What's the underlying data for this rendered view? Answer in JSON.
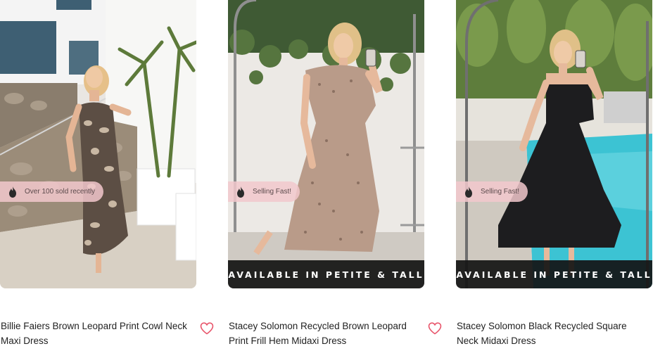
{
  "products": [
    {
      "title": "Billie Faiers Brown Leopard Print Cowl Neck Maxi Dress",
      "badge": "Over 100 sold recently",
      "banner": "",
      "heart_icon": "heart-outline-icon",
      "badge_icon": "flame-icon"
    },
    {
      "title": "Stacey Solomon Recycled Brown Leopard Print Frill Hem Midaxi Dress",
      "badge": "Selling Fast!",
      "banner": "AVAILABLE IN PETITE & TALL",
      "heart_icon": "heart-outline-icon",
      "badge_icon": "flame-icon"
    },
    {
      "title": "Stacey Solomon Black Recycled Square Neck Midaxi Dress",
      "badge": "Selling Fast!",
      "banner": "AVAILABLE IN PETITE & TALL",
      "heart_icon": "heart-outline-icon",
      "badge_icon": "flame-icon"
    }
  ],
  "colors": {
    "heart": "#e8556b",
    "badge_bg": "#f2c8cd",
    "banner_bg": "#141414"
  }
}
